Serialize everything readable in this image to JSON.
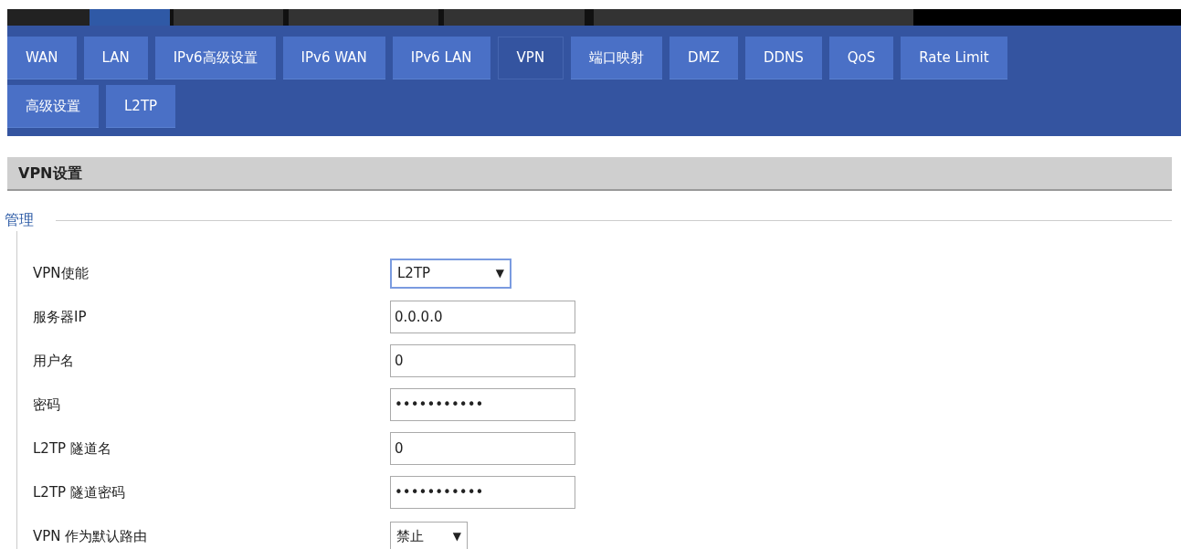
{
  "tabs": [
    {
      "label": "WAN",
      "selected": false
    },
    {
      "label": "LAN",
      "selected": false
    },
    {
      "label": "IPv6高级设置",
      "selected": false
    },
    {
      "label": "IPv6 WAN",
      "selected": false
    },
    {
      "label": "IPv6 LAN",
      "selected": false
    },
    {
      "label": "VPN",
      "selected": true
    },
    {
      "label": "端口映射",
      "selected": false
    },
    {
      "label": "DMZ",
      "selected": false
    },
    {
      "label": "DDNS",
      "selected": false
    },
    {
      "label": "QoS",
      "selected": false
    },
    {
      "label": "Rate Limit",
      "selected": false
    },
    {
      "label": "高级设置",
      "selected": false
    },
    {
      "label": "L2TP",
      "selected": false
    }
  ],
  "section_title": "VPN设置",
  "group": {
    "legend": "管理",
    "fields": [
      {
        "label": "VPN使能",
        "kind": "select",
        "value": "L2TP",
        "caret": "▼",
        "focused": true
      },
      {
        "label": "服务器IP",
        "kind": "text",
        "value": "0.0.0.0"
      },
      {
        "label": "用户名",
        "kind": "text",
        "value": "0"
      },
      {
        "label": "密码",
        "kind": "text",
        "value": "•••••••••••"
      },
      {
        "label": "L2TP 隧道名",
        "kind": "text",
        "value": "0"
      },
      {
        "label": "L2TP 隧道密码",
        "kind": "text",
        "value": "•••••••••••"
      },
      {
        "label": "VPN 作为默认路由",
        "kind": "select",
        "value": "禁止",
        "caret": "▼",
        "focused": false
      }
    ]
  }
}
